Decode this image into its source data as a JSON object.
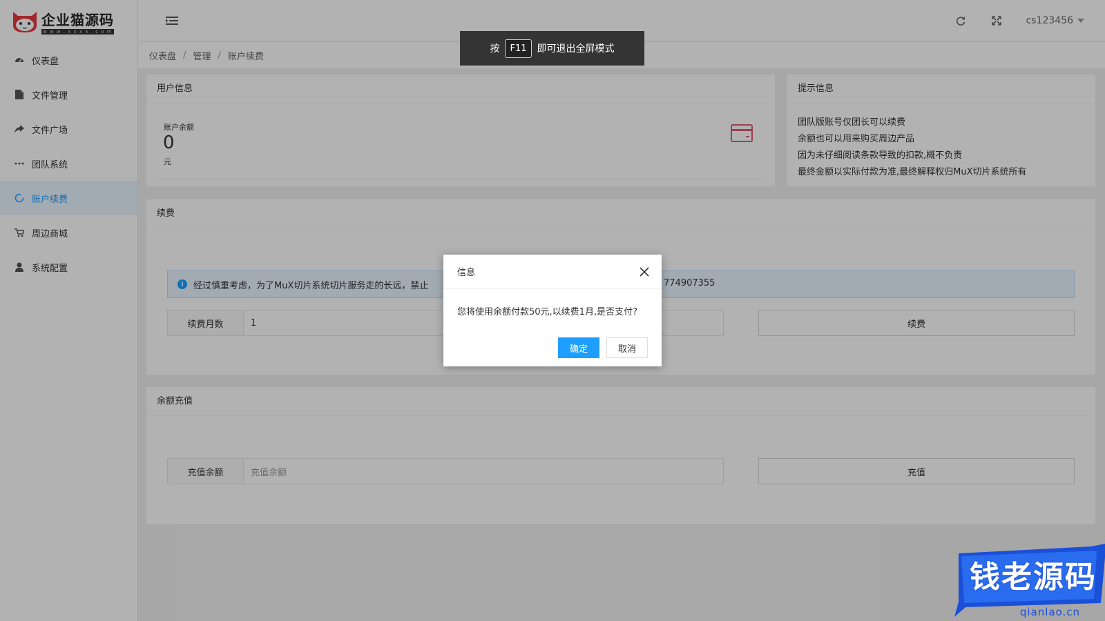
{
  "logo": {
    "title": "企业猫源码",
    "subtitle": "w w w . x x x x . c o m"
  },
  "sidebar": {
    "items": [
      {
        "label": "仪表盘",
        "icon": "dashboard-icon"
      },
      {
        "label": "文件管理",
        "icon": "file-icon"
      },
      {
        "label": "文件广场",
        "icon": "share-icon"
      },
      {
        "label": "团队系统",
        "icon": "more-icon"
      },
      {
        "label": "账户续费",
        "icon": "refresh-icon",
        "active": true
      },
      {
        "label": "周边商城",
        "icon": "cart-icon"
      },
      {
        "label": "系统配置",
        "icon": "user-icon"
      }
    ]
  },
  "header": {
    "username": "cs123456"
  },
  "breadcrumb": {
    "items": [
      "仪表盘",
      "管理",
      "账户续费"
    ]
  },
  "fullscreen_hint": {
    "prefix": "按",
    "key": "F11",
    "suffix": "即可退出全屏模式"
  },
  "user_info": {
    "title": "用户信息",
    "balance_label": "账户余额",
    "balance_value": "0",
    "balance_unit": "元"
  },
  "tips": {
    "title": "提示信息",
    "lines": [
      "团队版账号仅团长可以续费",
      "余额也可以用来购买周边产品",
      "因为未仔细阅读条款导致的扣款,概不负责",
      "最终金额以实际付款为准,最终解释权归MuX切片系统所有"
    ]
  },
  "renew": {
    "title": "续费",
    "notice": "经过慎重考虑，为了MuX切片系统切片服务走的长远，禁止",
    "notice_tail": "774907355",
    "months_label": "续费月数",
    "months_value": "1",
    "button": "续费"
  },
  "recharge": {
    "title": "余额充值",
    "amount_label": "充值余额",
    "amount_placeholder": "充值余额",
    "button": "充值"
  },
  "dialog": {
    "title": "信息",
    "message": "您将使用余额付款50元,以续费1月,是否支付?",
    "confirm": "确定",
    "cancel": "取消"
  },
  "watermark": {
    "text": "钱老源码",
    "url": "qianlao.cn"
  },
  "colors": {
    "accent": "#1e9fff",
    "active_bg": "#e8f4ff",
    "card_icon": "#e05a7a"
  }
}
